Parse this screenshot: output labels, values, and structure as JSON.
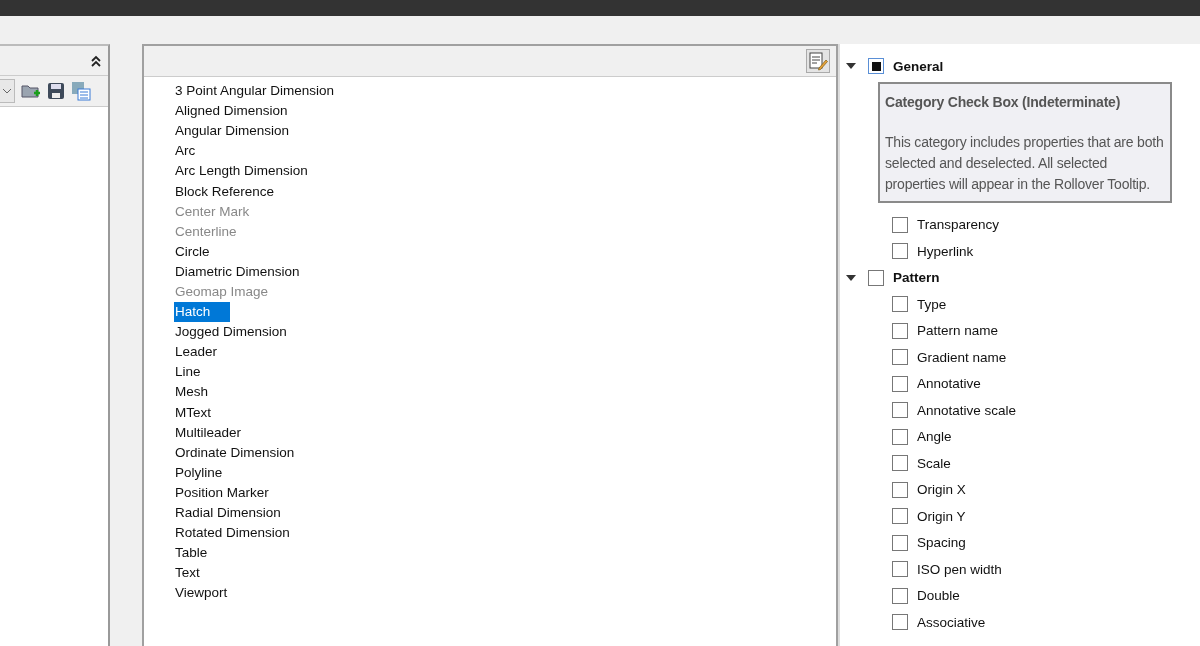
{
  "object_types": [
    {
      "label": "3 Point Angular Dimension",
      "disabled": false,
      "selected": false
    },
    {
      "label": "Aligned Dimension",
      "disabled": false,
      "selected": false
    },
    {
      "label": "Angular Dimension",
      "disabled": false,
      "selected": false
    },
    {
      "label": "Arc",
      "disabled": false,
      "selected": false
    },
    {
      "label": "Arc Length Dimension",
      "disabled": false,
      "selected": false
    },
    {
      "label": "Block Reference",
      "disabled": false,
      "selected": false
    },
    {
      "label": "Center Mark",
      "disabled": true,
      "selected": false
    },
    {
      "label": "Centerline",
      "disabled": true,
      "selected": false
    },
    {
      "label": "Circle",
      "disabled": false,
      "selected": false
    },
    {
      "label": "Diametric Dimension",
      "disabled": false,
      "selected": false
    },
    {
      "label": "Geomap Image",
      "disabled": true,
      "selected": false
    },
    {
      "label": "Hatch",
      "disabled": false,
      "selected": true
    },
    {
      "label": "Jogged Dimension",
      "disabled": false,
      "selected": false
    },
    {
      "label": "Leader",
      "disabled": false,
      "selected": false
    },
    {
      "label": "Line",
      "disabled": false,
      "selected": false
    },
    {
      "label": "Mesh",
      "disabled": false,
      "selected": false
    },
    {
      "label": "MText",
      "disabled": false,
      "selected": false
    },
    {
      "label": "Multileader",
      "disabled": false,
      "selected": false
    },
    {
      "label": "Ordinate Dimension",
      "disabled": false,
      "selected": false
    },
    {
      "label": "Polyline",
      "disabled": false,
      "selected": false
    },
    {
      "label": "Position Marker",
      "disabled": false,
      "selected": false
    },
    {
      "label": "Radial Dimension",
      "disabled": false,
      "selected": false
    },
    {
      "label": "Rotated Dimension",
      "disabled": false,
      "selected": false
    },
    {
      "label": "Table",
      "disabled": false,
      "selected": false
    },
    {
      "label": "Text",
      "disabled": false,
      "selected": false
    },
    {
      "label": "Viewport",
      "disabled": false,
      "selected": false
    }
  ],
  "properties": [
    {
      "label": "General",
      "expanded": true,
      "checked": false,
      "indeterminate": true,
      "children": [
        {
          "label": "Transparency",
          "checked": false
        },
        {
          "label": "Hyperlink",
          "checked": false
        }
      ]
    },
    {
      "label": "Pattern",
      "expanded": true,
      "checked": false,
      "indeterminate": false,
      "children": [
        {
          "label": "Type",
          "checked": false
        },
        {
          "label": "Pattern name",
          "checked": false
        },
        {
          "label": "Gradient name",
          "checked": false
        },
        {
          "label": "Annotative",
          "checked": false
        },
        {
          "label": "Annotative scale",
          "checked": false
        },
        {
          "label": "Angle",
          "checked": false
        },
        {
          "label": "Scale",
          "checked": false
        },
        {
          "label": "Origin X",
          "checked": false
        },
        {
          "label": "Origin Y",
          "checked": false
        },
        {
          "label": "Spacing",
          "checked": false
        },
        {
          "label": "ISO pen width",
          "checked": false
        },
        {
          "label": "Double",
          "checked": false
        },
        {
          "label": "Associative",
          "checked": false
        }
      ]
    }
  ],
  "tooltip": {
    "title": "Category Check Box (Indeterminate)",
    "body": "This category includes properties that are both selected and deselected. All selected properties will appear in the Rollover Tooltip."
  }
}
